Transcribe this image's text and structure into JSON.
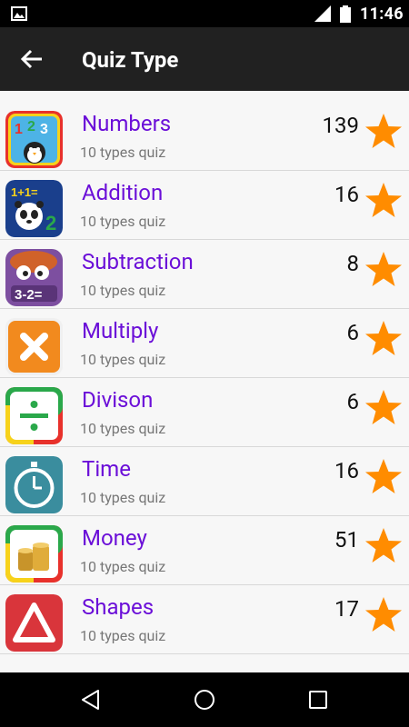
{
  "status_bar": {
    "time": "11:46",
    "icons": [
      "gallery-icon",
      "signal-icon",
      "battery-icon"
    ]
  },
  "toolbar": {
    "title": "Quiz Type",
    "back_icon": "arrow-back-icon"
  },
  "quiz_types": [
    {
      "name": "Numbers",
      "subtitle": "10 types quiz",
      "count": "139",
      "icon": "numbers-123-penguin-icon"
    },
    {
      "name": "Addition",
      "subtitle": "10 types quiz",
      "count": "16",
      "icon": "addition-panda-icon"
    },
    {
      "name": "Subtraction",
      "subtitle": "10 types quiz",
      "count": "8",
      "icon": "subtraction-monster-icon"
    },
    {
      "name": "Multiply",
      "subtitle": "10 types quiz",
      "count": "6",
      "icon": "multiply-icon"
    },
    {
      "name": "Divison",
      "subtitle": "10 types quiz",
      "count": "6",
      "icon": "division-icon"
    },
    {
      "name": "Time",
      "subtitle": "10 types quiz",
      "count": "16",
      "icon": "stopwatch-icon"
    },
    {
      "name": "Money",
      "subtitle": "10 types quiz",
      "count": "51",
      "icon": "coins-icon"
    },
    {
      "name": "Shapes",
      "subtitle": "10 types quiz",
      "count": "17",
      "icon": "triangle-shape-icon"
    }
  ],
  "colors": {
    "title_purple": "#6b0fd8",
    "star_orange": "#ff8c00",
    "toolbar": "#212121"
  },
  "nav_bar": {
    "icons": [
      "back-triangle-icon",
      "home-circle-icon",
      "recents-square-icon"
    ]
  }
}
